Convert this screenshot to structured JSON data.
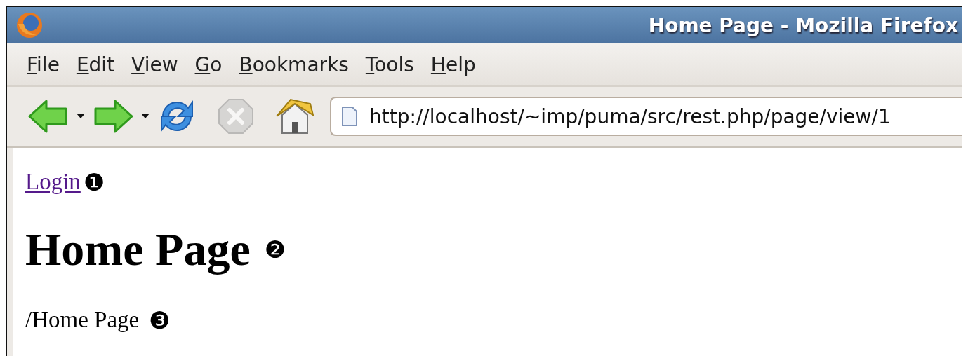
{
  "window": {
    "title": "Home Page - Mozilla Firefox"
  },
  "menu": [
    "File",
    "Edit",
    "View",
    "Go",
    "Bookmarks",
    "Tools",
    "Help"
  ],
  "toolbar": {
    "back_enabled": true,
    "forward_enabled": true,
    "stop_enabled": false,
    "address": "http://localhost/~imp/puma/src/rest.php/page/view/1"
  },
  "content": {
    "link": {
      "label": "Login",
      "visited": true,
      "marker": "❶"
    },
    "heading": {
      "text": "Home Page",
      "marker": "❷"
    },
    "path": {
      "text": "/Home Page",
      "marker": "❸"
    }
  }
}
